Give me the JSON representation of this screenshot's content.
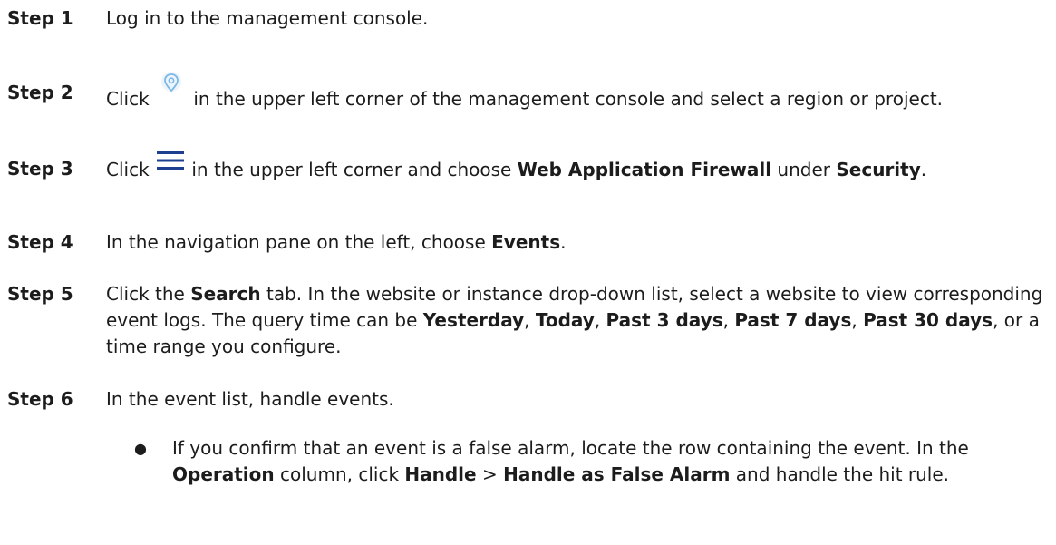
{
  "steps": [
    {
      "label": "Step 1",
      "parts": [
        "Log in to the management console."
      ]
    },
    {
      "label": "Step 2",
      "parts": [
        "Click ",
        " in the upper left corner of the management console and select a region or project."
      ]
    },
    {
      "label": "Step 3",
      "parts": [
        "Click ",
        " in the upper left corner and choose ",
        "Web Application Firewall",
        " under ",
        "Security",
        "."
      ]
    },
    {
      "label": "Step 4",
      "parts": [
        "In the navigation pane on the left, choose ",
        "Events",
        "."
      ]
    },
    {
      "label": "Step 5",
      "parts": [
        "Click the ",
        "Search",
        " tab. In the website or instance drop-down list, select a website to view corresponding event logs. The query time can be ",
        "Yesterday",
        ", ",
        "Today",
        ", ",
        "Past 3 days",
        ", ",
        "Past 7 days",
        ", ",
        "Past 30 days",
        ", or a time range you configure."
      ]
    },
    {
      "label": "Step 6",
      "parts": [
        "In the event list, handle events."
      ]
    }
  ],
  "bullets": [
    {
      "symbol": "●",
      "parts": [
        "If you confirm that an event is a false alarm, locate the row containing the event. In the ",
        "Operation",
        " column, click ",
        "Handle",
        " > ",
        "Handle as False Alarm",
        " and handle the hit rule."
      ]
    }
  ],
  "icons": {
    "region_icon": "location-pin-icon",
    "menu_icon": "hamburger-menu-icon",
    "pin_color": "#7ab8e8",
    "menu_color": "#1d3f8f"
  }
}
